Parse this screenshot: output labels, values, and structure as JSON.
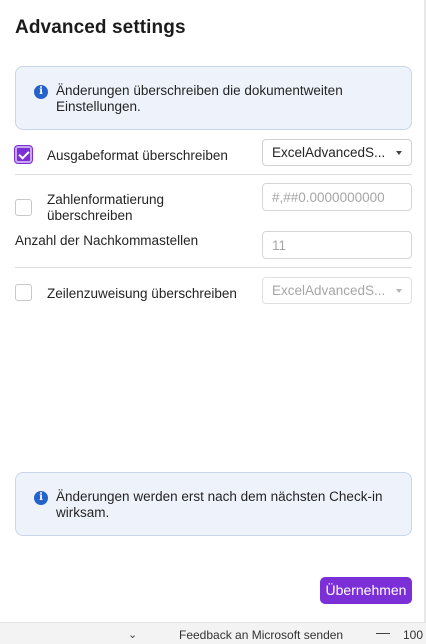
{
  "panel": {
    "title": "Advanced settings"
  },
  "info_top": {
    "icon": "info-icon",
    "text": "Änderungen überschreiben die dokumentweiten Einstellungen."
  },
  "output_format": {
    "label": "Ausgabeformat überschreiben",
    "checked": true,
    "select_value": "ExcelAdvancedS..."
  },
  "number_format": {
    "label": "Zahlenformatierung überschreiben",
    "checked": false,
    "placeholder": "#,##0.0000000000"
  },
  "decimals": {
    "label": "Anzahl der Nachkommastellen",
    "placeholder": "11"
  },
  "row_assignment": {
    "label": "Zeilenzuweisung überschreiben",
    "checked": false,
    "select_value": "ExcelAdvancedS..."
  },
  "info_bottom": {
    "icon": "info-icon",
    "text": "Änderungen werden erst nach dem nächsten Check-in wirksam."
  },
  "actions": {
    "apply_label": "Übernehmen"
  },
  "status_bar": {
    "feedback_label": "Feedback an Microsoft senden",
    "zoom_minus": "—",
    "zoom_value": "100"
  },
  "colors": {
    "accent": "#7b2fd6",
    "info_bg": "#eef3fb",
    "info_icon": "#2563c9"
  }
}
